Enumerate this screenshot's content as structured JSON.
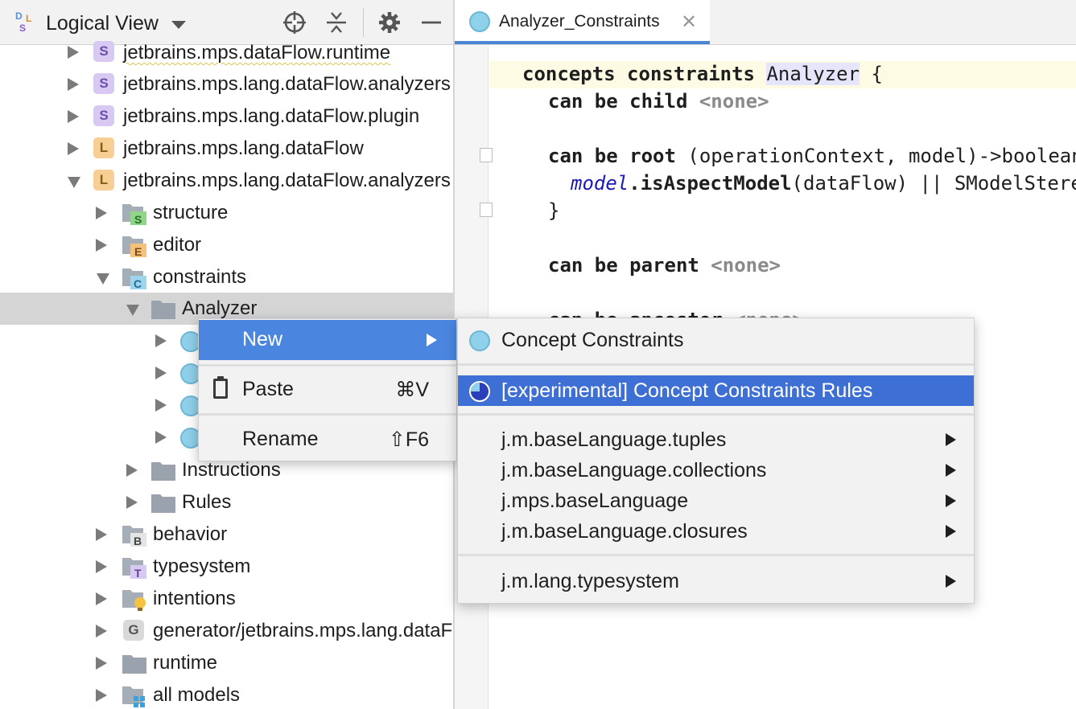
{
  "left_panel": {
    "title": "Logical View",
    "tree": [
      {
        "label": "jetbrains.mps.dataFlow.runtime",
        "badge": "S"
      },
      {
        "label": "jetbrains.mps.lang.dataFlow.analyzers",
        "badge": "S"
      },
      {
        "label": "jetbrains.mps.lang.dataFlow.plugin",
        "badge": "S"
      },
      {
        "label": "jetbrains.mps.lang.dataFlow",
        "badge": "L"
      },
      {
        "label": "jetbrains.mps.lang.dataFlow.analyzers",
        "badge": "L"
      },
      {
        "label": "structure",
        "badge": "S"
      },
      {
        "label": "editor",
        "badge": "E"
      },
      {
        "label": "constraints",
        "badge": "C"
      },
      {
        "label": "Analyzer"
      },
      {
        "label": "Instructions"
      },
      {
        "label": "Rules"
      },
      {
        "label": "behavior",
        "badge": "B"
      },
      {
        "label": "typesystem",
        "badge": "T"
      },
      {
        "label": "intentions"
      },
      {
        "label": "generator/jetbrains.mps.lang.dataFlow.analyzers",
        "badge": "G"
      },
      {
        "label": "runtime"
      },
      {
        "label": "all models"
      }
    ]
  },
  "editor": {
    "tab_label": "Analyzer_Constraints",
    "code": {
      "l1_kw": "concepts constraints",
      "l1_ref": "Analyzer",
      "l1_end": " {",
      "l2_kw": "can be child",
      "l2_val": "<none>",
      "l3_kw": "can be root",
      "l3_rest": " (operationContext, model)->boolean {",
      "l4_ref": "model",
      "l4_method": ".isAspectModel",
      "l4_rest": "(dataFlow) || SModelStereotype",
      "l5": "}",
      "l6_kw": "can be parent",
      "l6_val": "<none>",
      "l7_kw": "can be ancestor",
      "l7_val": "<none>"
    }
  },
  "context_menu": {
    "new_label": "New",
    "paste_label": "Paste",
    "paste_shortcut": "⌘V",
    "rename_label": "Rename",
    "rename_shortcut": "⇧F6"
  },
  "submenu": {
    "items": [
      "Concept Constraints",
      "[experimental] Concept Constraints Rules",
      "j.m.baseLanguage.tuples",
      "j.m.baseLanguage.collections",
      "j.mps.baseLanguage",
      "j.m.baseLanguage.closures",
      "j.m.lang.typesystem"
    ]
  },
  "colors": {
    "selection": "#4a86e0",
    "submenu_selection": "#3d6fd4",
    "tree_selection": "#d5d5d5",
    "language_badge": "#f7cf94",
    "solution_badge": "#d8c9f2"
  }
}
